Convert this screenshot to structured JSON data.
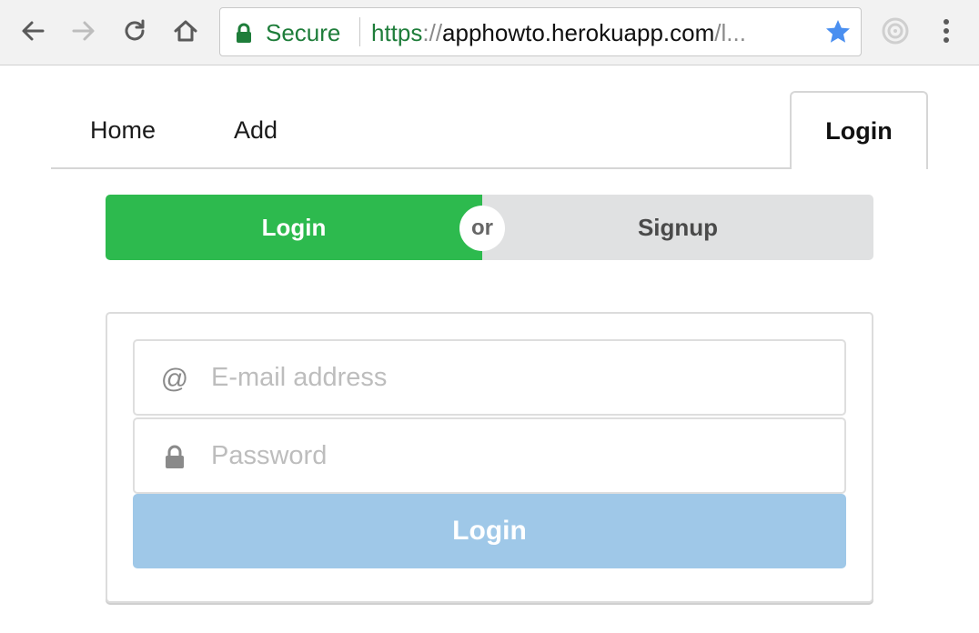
{
  "browser": {
    "secure_label": "Secure",
    "url_scheme": "https",
    "url_separator": "://",
    "url_host": "apphowto.herokuapp.com",
    "url_rest": "/l...",
    "icons": [
      "back-arrow-icon",
      "forward-arrow-icon",
      "reload-icon",
      "home-icon",
      "lock-icon",
      "star-icon",
      "extension-icon",
      "menu-dots-icon"
    ],
    "colors": {
      "secure": "#1e7d3a",
      "star": "#4a8ff0"
    }
  },
  "nav": {
    "items": [
      {
        "label": "Home"
      },
      {
        "label": "Add"
      }
    ],
    "active_label": "Login"
  },
  "toggle": {
    "login_label": "Login",
    "or_label": "or",
    "signup_label": "Signup",
    "colors": {
      "login": "#2dba4e",
      "signup": "#e0e1e2"
    }
  },
  "form": {
    "email_icon": "@",
    "email_placeholder": "E-mail address",
    "email_value": "",
    "password_placeholder": "Password",
    "password_value": "",
    "submit_label": "Login",
    "colors": {
      "submit": "#9fc8e8"
    }
  }
}
